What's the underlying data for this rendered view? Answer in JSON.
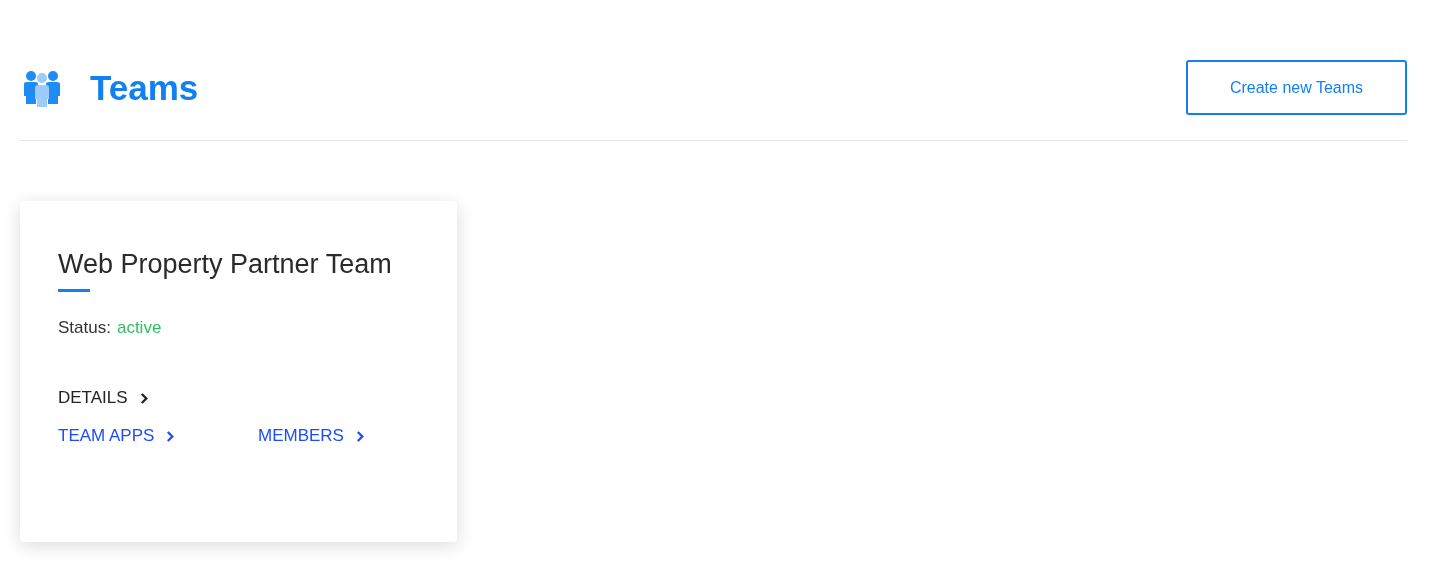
{
  "header": {
    "title": "Teams",
    "button": "Create new Teams"
  },
  "teams": [
    {
      "name": "Web Property Partner Team",
      "status_label": "Status:",
      "status": "active",
      "links": [
        {
          "label": "DETAILS",
          "kind": "dark"
        },
        {
          "label": "TEAM APPS",
          "kind": "blue"
        },
        {
          "label": "MEMBERS",
          "kind": "blue"
        }
      ]
    }
  ]
}
